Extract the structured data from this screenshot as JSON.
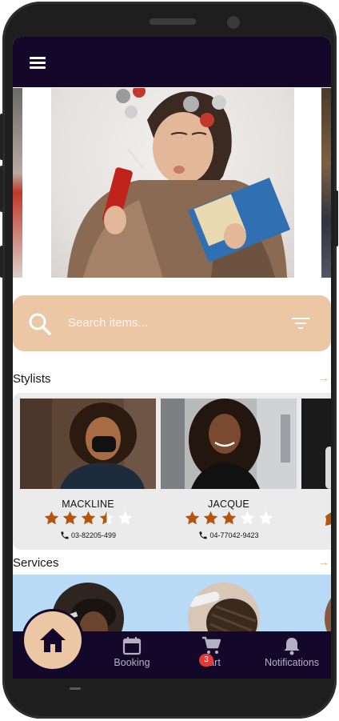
{
  "app": {
    "menu_icon": "hamburger-icon"
  },
  "search": {
    "placeholder": "Search items...",
    "icon": "search-icon",
    "filter_icon": "filter-icon"
  },
  "stylists": {
    "title": "Stylists",
    "more_icon": "arrow-right-icon",
    "items": [
      {
        "name": "MACKLINE",
        "rating": 3.5,
        "phone": "03-82205-499"
      },
      {
        "name": "JACQUE",
        "rating": 3,
        "phone": "04-77042-9423"
      }
    ]
  },
  "services": {
    "title": "Services",
    "more_icon": "arrow-right-icon"
  },
  "nav": {
    "home_icon": "home-icon",
    "booking": "Booking",
    "cart": "Cart",
    "cart_count": "3",
    "notifications": "Notifications"
  },
  "colors": {
    "topbar": "#13082a",
    "accent": "#ecc7a5",
    "star": "#b5540b",
    "services_bg": "#b9daf6",
    "badge": "#e53935"
  }
}
